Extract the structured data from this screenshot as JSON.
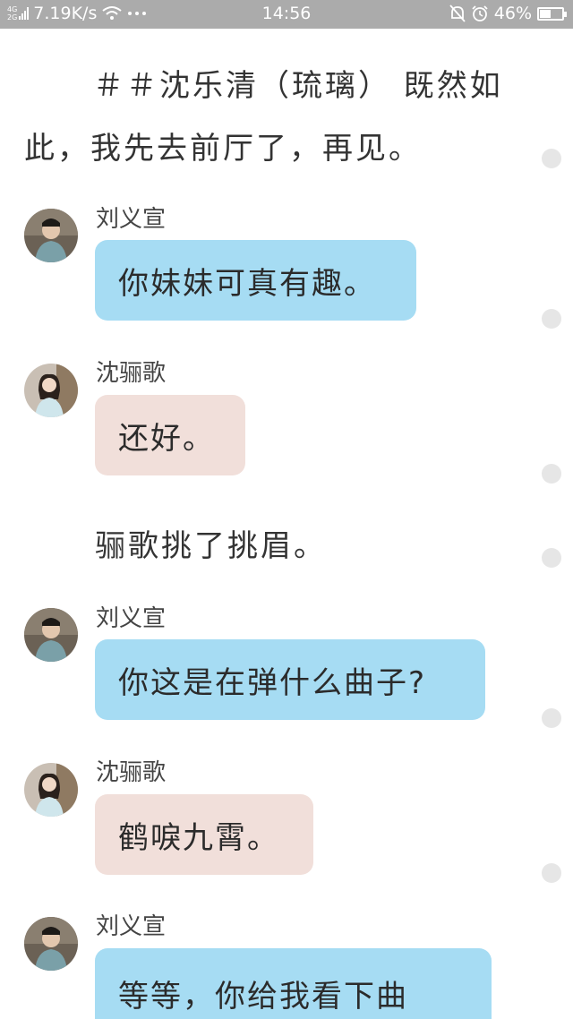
{
  "status_bar": {
    "network_top": "4G",
    "network_bottom": "2G",
    "speed": "7.19K/s",
    "time": "14:56",
    "battery_percent": "46%",
    "battery_level": 0.46,
    "icons": [
      "signal-icon",
      "wifi-icon",
      "more-dots-icon",
      "bell-off-icon",
      "alarm-clock-icon",
      "battery-icon"
    ]
  },
  "narration_1": {
    "line1": "＃＃沈乐清（琉璃） 既然如",
    "line2": "此，我先去前厅了，再见。"
  },
  "narration_2": "骊歌挑了挑眉。",
  "messages": [
    {
      "speaker": "刘义宣",
      "text": "你妹妹可真有趣。",
      "bubble_color": "#a6dcf3"
    },
    {
      "speaker": "沈骊歌",
      "text": "还好。",
      "bubble_color": "#f1dfda"
    },
    {
      "speaker": "刘义宣",
      "text": "你这是在弹什么曲子?",
      "bubble_color": "#a6dcf3"
    },
    {
      "speaker": "沈骊歌",
      "text": "鹤唳九霄。",
      "bubble_color": "#f1dfda"
    },
    {
      "speaker": "刘义宣",
      "text": "等等，你给我看下曲",
      "bubble_color": "#a6dcf3"
    }
  ]
}
